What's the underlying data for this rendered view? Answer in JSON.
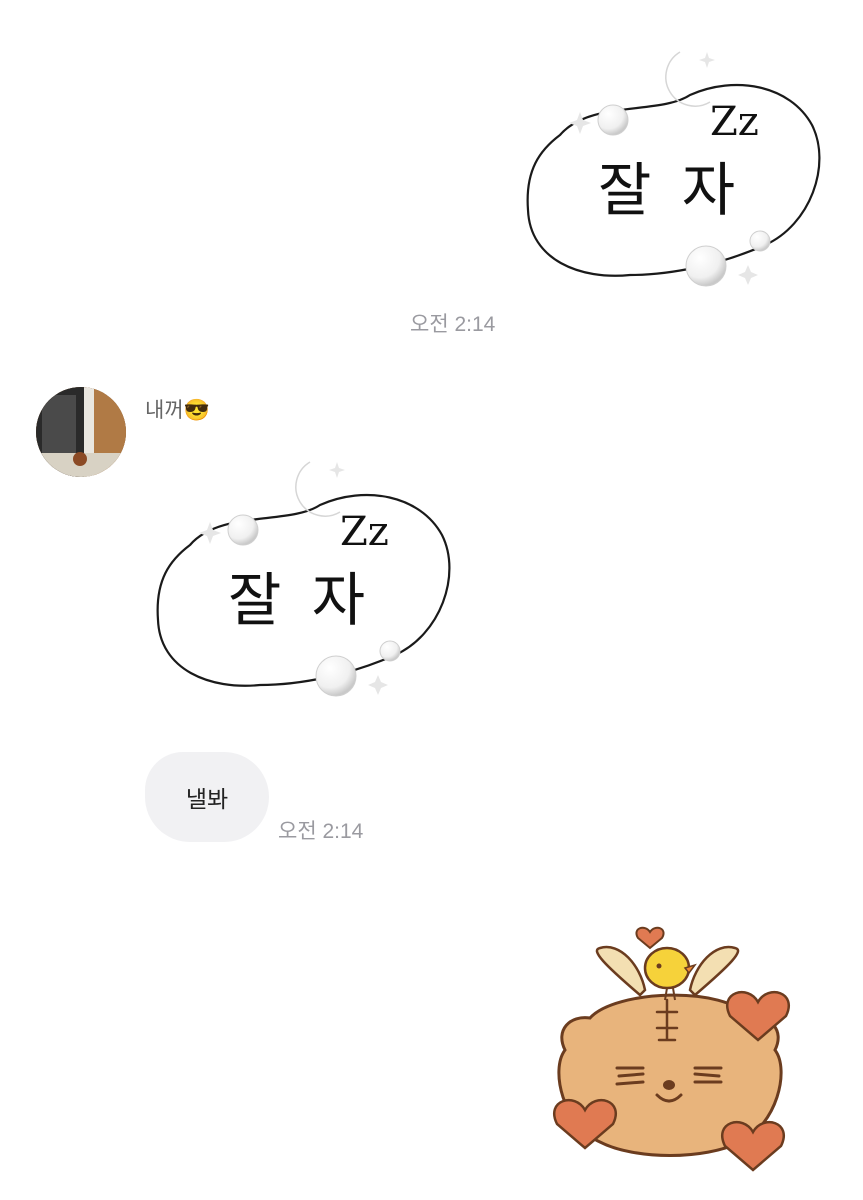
{
  "messages": {
    "sticker_top": {
      "text": "잘 자",
      "zz": "Zz"
    },
    "time_1": "오전 2:14",
    "sender": {
      "name": "내꺼😎"
    },
    "sticker_middle": {
      "text": "잘 자",
      "zz": "Zz"
    },
    "bubble_text": "낼봐",
    "time_2": "오전 2:14"
  }
}
